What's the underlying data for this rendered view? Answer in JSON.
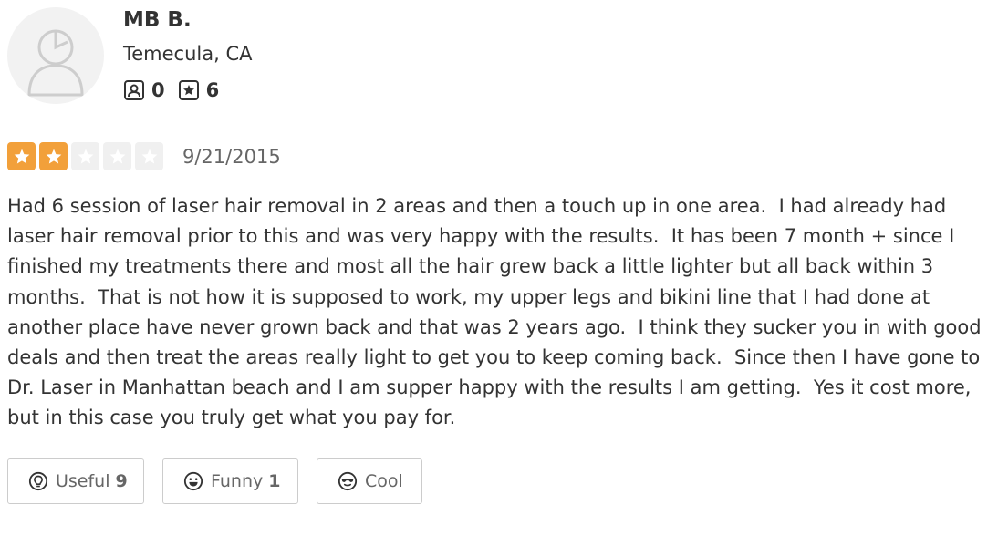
{
  "user": {
    "name": "MB B.",
    "location": "Temecula, CA",
    "friends_count": "0",
    "reviews_count": "6"
  },
  "review": {
    "rating": 2,
    "rating_max": 5,
    "date": "9/21/2015",
    "text": "Had 6 session of laser hair removal in 2 areas and then a touch up in one area.  I had already had laser hair removal prior to this and was very happy with the results.  It has been 7 month + since I finished my treatments there and most all the hair grew back a little lighter but all back within 3 months.  That is not how it is supposed to work, my upper legs and bikini line that I had done at another place have never grown back and that was 2 years ago.  I think they sucker you in with good deals and then treat the areas really light to get you to keep coming back.  Since then I have gone to Dr. Laser in Manhattan beach and I am supper happy with the results I am getting.  Yes it cost more, but in this case you truly get what you pay for."
  },
  "votes": {
    "useful_label": "Useful",
    "useful_count": "9",
    "funny_label": "Funny",
    "funny_count": "1",
    "cool_label": "Cool"
  },
  "colors": {
    "star_filled": "#f2a03a",
    "star_empty": "#f0f0f0",
    "text": "#333333",
    "muted": "#666666"
  },
  "icons": {
    "avatar": "default-user-avatar-icon",
    "friends": "friends-icon",
    "reviews": "review-star-icon",
    "useful": "lightbulb-icon",
    "funny": "smile-icon",
    "cool": "sunglasses-icon"
  }
}
